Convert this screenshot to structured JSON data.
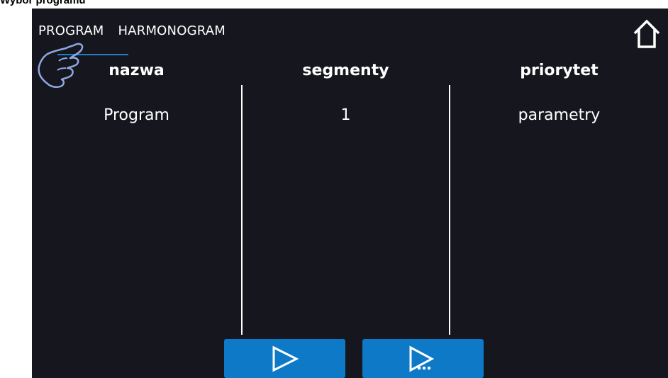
{
  "document": {
    "caption": "Wybór programu"
  },
  "tabs": [
    {
      "label": "PROGRAM",
      "active": true
    },
    {
      "label": "HARMONOGRAM",
      "active": false
    }
  ],
  "table": {
    "columns": [
      "nazwa",
      "segmenty",
      "priorytet"
    ],
    "rows": [
      [
        "Program",
        "1",
        "parametry"
      ]
    ]
  },
  "buttons": {
    "play": {
      "icon": "play-icon"
    },
    "play_more": {
      "icon": "play-more-icon"
    }
  },
  "icons": {
    "home": "home-icon",
    "hand": "tap-hand-icon"
  },
  "colors": {
    "screen_bg": "#16161f",
    "accent": "#0e79c7",
    "text": "#ffffff",
    "hand_outline": "#8fa8e0"
  }
}
